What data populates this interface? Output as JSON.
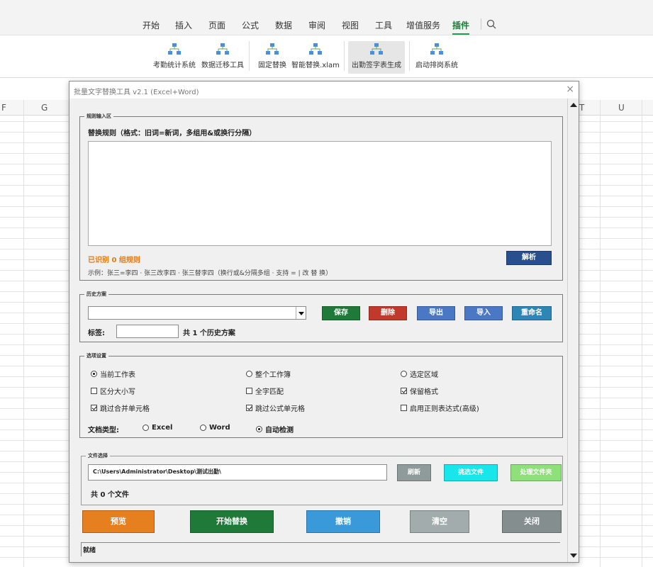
{
  "ribbon": {
    "tabs": [
      "开始",
      "插入",
      "页面",
      "公式",
      "数据",
      "审阅",
      "视图",
      "工具",
      "增值服务",
      "插件"
    ],
    "active_tab": "插件",
    "buttons": [
      "考勤统计系统",
      "数据迁移工具",
      "固定替换",
      "智能替换.xlam",
      "出勤签字表生成",
      "启动排岗系统"
    ]
  },
  "sheet": {
    "columns_left": [
      "F",
      "G"
    ],
    "columns_right": [
      "T",
      "U"
    ]
  },
  "dialog": {
    "title": "批量文字替换工具 v2.1 (Excel+Word)",
    "close": "×",
    "rules": {
      "legend": "规则输入区",
      "heading": "替换规则（格式：旧词=新词，多组用&或换行分隔）",
      "recognized": "已识别 0 组规则",
      "parse_button": "解析",
      "example": "示例：张三=李四 · 张三改李四 · 张三替李四（换行或&分隔多组 · 支持 = | 改 替 换）"
    },
    "history": {
      "legend": "历史方案",
      "save": "保存",
      "delete": "删除",
      "export": "导出",
      "import": "导入",
      "rename": "重命名",
      "tag_label": "标签:",
      "count": "共 1 个历史方案"
    },
    "options": {
      "legend": "选项设置",
      "current_sheet": "当前工作表",
      "whole_workbook": "整个工作簿",
      "selection": "选定区域",
      "case_sensitive": "区分大小写",
      "whole_match": "全字匹配",
      "keep_format": "保留格式",
      "skip_merged": "跳过合并单元格",
      "skip_formula": "跳过公式单元格",
      "regex": "启用正则表达式(高级)",
      "doc_type_label": "文档类型:",
      "excel": "Excel",
      "word": "Word",
      "auto": "自动检测"
    },
    "files": {
      "legend": "文件选择",
      "path": "C:\\Users\\Administrator\\Desktop\\测试出勤\\",
      "refresh": "刷新",
      "select_files": "挑选文件",
      "process_folder": "处理文件夹",
      "count": "共 0 个文件"
    },
    "actions": {
      "preview": "预览",
      "start": "开始替换",
      "undo": "撤销",
      "clear": "清空",
      "close": "关闭"
    },
    "status": "就绪"
  },
  "colors": {
    "green": "#1f7a3a",
    "red": "#c0392b",
    "blue": "#4a78c4",
    "teal": "#2e86b5",
    "navy": "#2a4f8f",
    "orange": "#e6801f",
    "cyan": "#17e6ea",
    "lightgreen": "#8ee07a",
    "gray": "#8f9a9a",
    "sky": "#3a9ad9"
  }
}
